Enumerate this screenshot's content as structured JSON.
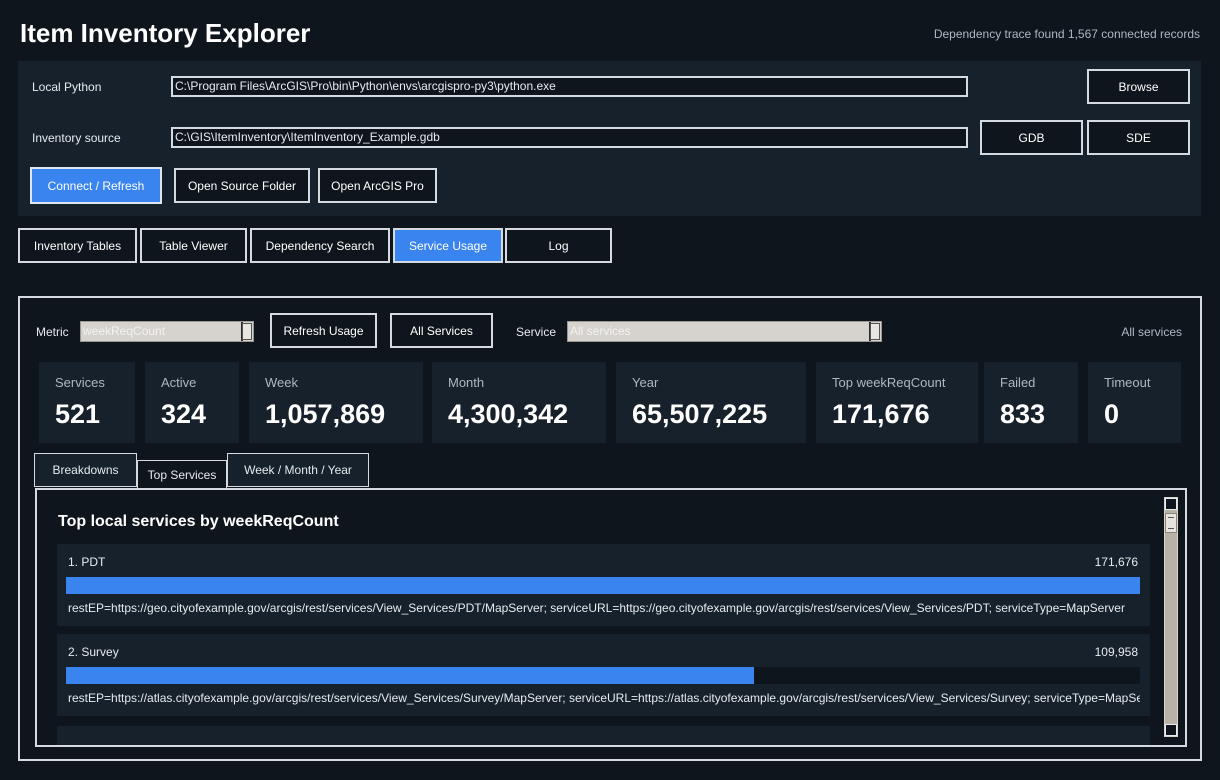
{
  "app": {
    "title": "Item Inventory Explorer",
    "status": "Dependency trace found 1,567 connected records"
  },
  "connection": {
    "python_label": "Local Python",
    "python_value": "C:\\Program Files\\ArcGIS\\Pro\\bin\\Python\\envs\\arcgispro-py3\\python.exe",
    "browse_label": "Browse",
    "source_label": "Inventory source",
    "source_value": "C:\\GIS\\ItemInventory\\ItemInventory_Example.gdb",
    "gdb_label": "GDB",
    "sde_label": "SDE",
    "connect_label": "Connect / Refresh",
    "open_folder_label": "Open Source Folder",
    "open_pro_label": "Open ArcGIS Pro"
  },
  "tabs": [
    {
      "label": "Inventory Tables",
      "active": false
    },
    {
      "label": "Table Viewer",
      "active": false
    },
    {
      "label": "Dependency Search",
      "active": false
    },
    {
      "label": "Service Usage",
      "active": true
    },
    {
      "label": "Log",
      "active": false
    }
  ],
  "usage": {
    "metric_label": "Metric",
    "metric_value": "weekReqCount",
    "refresh_label": "Refresh Usage",
    "all_services_label": "All Services",
    "service_label": "Service",
    "service_value": "All services",
    "scope_label": "All services",
    "cards": [
      {
        "label": "Services",
        "value": "521"
      },
      {
        "label": "Active",
        "value": "324"
      },
      {
        "label": "Week",
        "value": "1,057,869"
      },
      {
        "label": "Month",
        "value": "4,300,342"
      },
      {
        "label": "Year",
        "value": "65,507,225"
      },
      {
        "label": "Top weekReqCount",
        "value": "171,676"
      },
      {
        "label": "Failed",
        "value": "833"
      },
      {
        "label": "Timeout",
        "value": "0"
      }
    ],
    "subtabs": [
      {
        "label": "Breakdowns",
        "active": false
      },
      {
        "label": "Top Services",
        "active": true
      },
      {
        "label": "Week / Month / Year",
        "active": false
      }
    ],
    "list_title": "Top local services by weekReqCount",
    "services": [
      {
        "name": "1. PDT",
        "count": "171,676",
        "fraction": 1.0,
        "detail": "restEP=https://geo.cityofexample.gov/arcgis/rest/services/View_Services/PDT/MapServer; serviceURL=https://geo.cityofexample.gov/arcgis/rest/services/View_Services/PDT; serviceType=MapServer"
      },
      {
        "name": "2. Survey",
        "count": "109,958",
        "fraction": 0.6405,
        "detail": "restEP=https://atlas.cityofexample.gov/arcgis/rest/services/View_Services/Survey/MapServer; serviceURL=https://atlas.cityofexample.gov/arcgis/rest/services/View_Services/Survey; serviceType=MapServer"
      }
    ]
  },
  "colors": {
    "accent": "#3a84f0",
    "background": "#0e151c",
    "panel": "#17212b"
  }
}
